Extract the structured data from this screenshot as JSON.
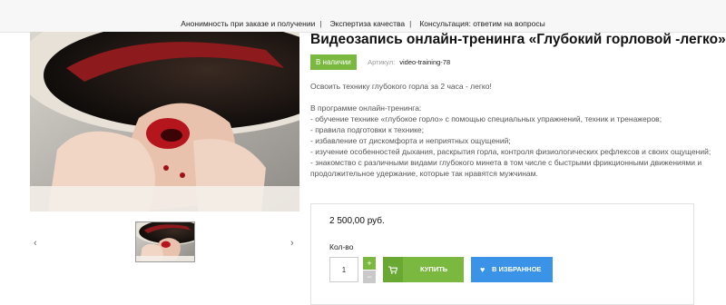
{
  "top_nav": {
    "items": [
      "Анонимность при заказе и получении",
      "Экспертиза качества",
      "Консультация: ответим на вопросы"
    ],
    "separator": "|"
  },
  "product": {
    "title": "Видеозапись онлайн-тренинга «Глубокий горловой -легко»",
    "stock_badge": "В наличии",
    "sku_label": "Артикул:",
    "sku_value": "video-training-78",
    "description": {
      "lead": "Освоить технику глубокого горла за 2 часа - легко!",
      "intro": "В программе онлайн-тренинга:",
      "items": [
        "- обучение технике «глубокое горло» с помощью специальных упражнений, техник и тренажеров;",
        "- правила подготовки к технике;",
        "- избавление от дискомфорта и неприятных ощущений;",
        "- изучение особенностей дыхания, раскрытия горла, контроля физиологических рефлексов и своих ощущений;",
        "- знакомство с различными видами глубокого минета в том числе с быстрыми фрикционными движениями и продолжительное удержание, которые так нравятся мужчинам."
      ]
    }
  },
  "gallery": {
    "main_image_icon": "product-photo",
    "prev_arrow": "‹",
    "next_arrow": "›",
    "thumb_icon": "product-thumbnail"
  },
  "buy_box": {
    "price": "2 500,00 руб.",
    "qty_label": "Кол-во",
    "qty_value": "1",
    "plus": "+",
    "minus": "−",
    "buy_label": "КУПИТЬ",
    "buy_icon": "cart-icon",
    "fav_label": "В ИЗБРАННОЕ",
    "fav_icon": "heart-icon"
  },
  "colors": {
    "accent_green": "#7ab840",
    "accent_blue": "#3a93e6",
    "topbar_bg": "#f7f7f7"
  }
}
